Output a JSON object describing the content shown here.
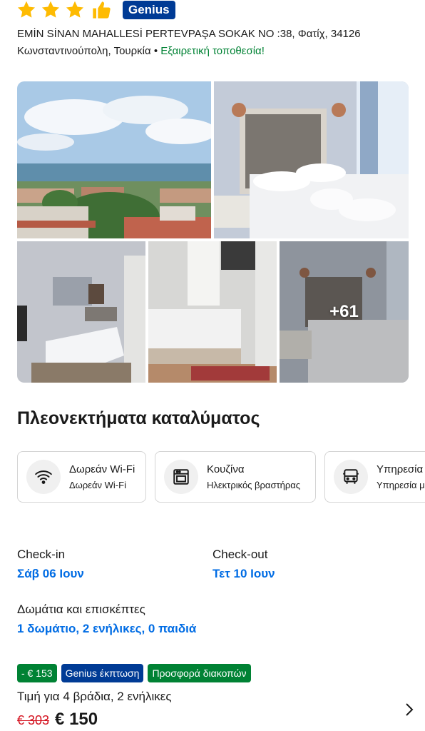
{
  "header": {
    "genius_badge": "Genius",
    "address_line1": "EMİN SİNAN MAHALLESİ PERTEVPAŞA SOKAK NO :38, Φατίχ, 34126",
    "address_city": "Κωνσταντινούπολη, Τουρκία",
    "separator": " • ",
    "location_rating": "Εξαιρετική τοποθεσία!",
    "icons": [
      "star-icon",
      "star-icon",
      "star-icon",
      "thumbs-up-icon"
    ]
  },
  "gallery": {
    "more_photos": "+61"
  },
  "facilities": {
    "title": "Πλεονεκτήματα καταλύματος",
    "items": [
      {
        "title": "Δωρεάν Wi-Fi",
        "subtitle": "Δωρεάν Wi-Fi",
        "icon": "wifi-icon"
      },
      {
        "title": "Κουζίνα",
        "subtitle": "Ηλεκτρικός βραστήρας",
        "icon": "oven-icon"
      },
      {
        "title": "Υπηρεσία",
        "subtitle": "Υπηρεσία μ",
        "icon": "bus-icon"
      }
    ]
  },
  "booking": {
    "checkin_label": "Check-in",
    "checkin_value": "Σάβ 06 Ιουν",
    "checkout_label": "Check-out",
    "checkout_value": "Τετ 10 Ιουν",
    "rooms_label": "Δωμάτια και επισκέπτες",
    "rooms_value": "1 δωμάτιο, 2 ενήλικες, 0 παιδιά"
  },
  "price": {
    "tags": [
      {
        "label": "- € 153",
        "color": "#008234"
      },
      {
        "label": "Genius έκπτωση",
        "color": "#003b95"
      },
      {
        "label": "Προσφορά διακοπών",
        "color": "#008234"
      }
    ],
    "price_for": "Τιμή για 4 βράδια, 2 ενήλικες",
    "old_price": "€ 303",
    "new_price": "€ 150"
  },
  "colors": {
    "brand_blue": "#003b95",
    "link_blue": "#006ce4",
    "green": "#008234",
    "red": "#d4111e",
    "star_yellow": "#febb02"
  }
}
